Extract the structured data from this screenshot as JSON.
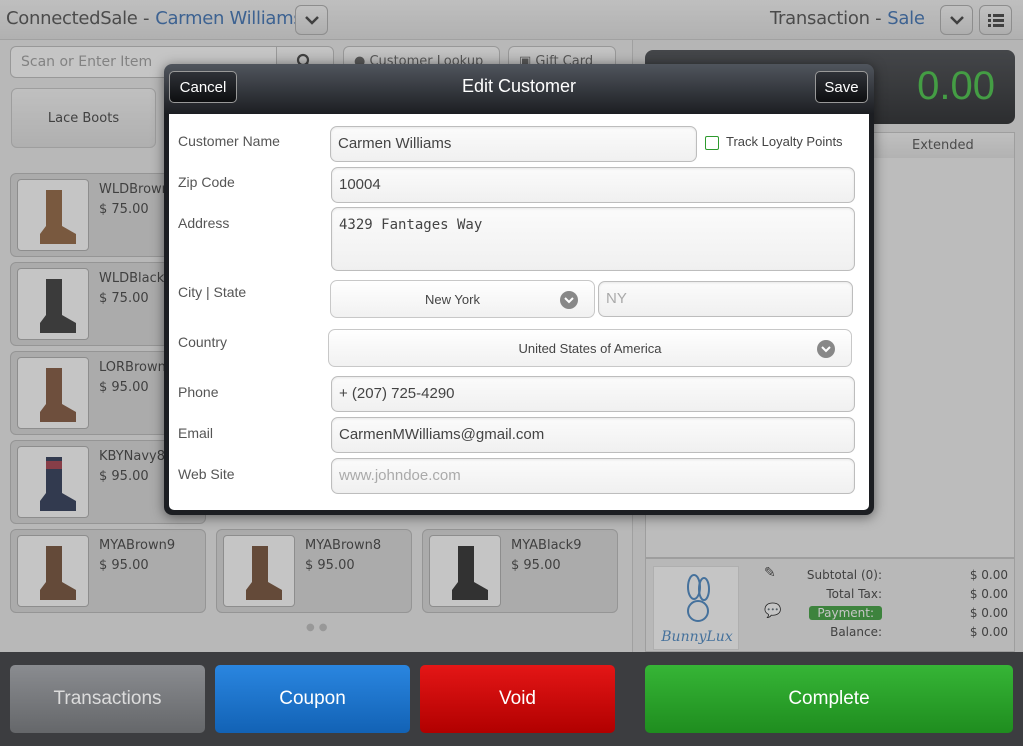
{
  "header": {
    "app_name": "ConnectedSale -",
    "customer": "Carmen Williams",
    "transaction_label": "Transaction -",
    "transaction_type": "Sale"
  },
  "toolbar": {
    "scan_placeholder": "Scan or Enter Item",
    "customer_lookup": "Customer Lookup",
    "gift_card": "Gift Card"
  },
  "categories": [
    {
      "label": "Lace Boots"
    }
  ],
  "products": [
    {
      "name": "WLDBrown",
      "price": "$ 75.00",
      "color": "#8a5a32"
    },
    {
      "name": "WLDBlack",
      "price": "$ 75.00",
      "color": "#2b2b2b"
    },
    {
      "name": "LORBrown",
      "price": "$ 95.00",
      "color": "#7a4a2e"
    },
    {
      "name": "KBYNavy8",
      "price": "$ 95.00",
      "color": "#1e2a4a"
    },
    {
      "name": "MYABrown9",
      "price": "$ 95.00",
      "color": "#6a4328"
    },
    {
      "name": "MYABrown8",
      "price": "$ 95.00",
      "color": "#6a4328"
    },
    {
      "name": "MYABlack9",
      "price": "$ 95.00",
      "color": "#1e1e1e"
    }
  ],
  "total": {
    "symbol": "$",
    "amount": "0.00"
  },
  "grid": {
    "extended_header": "Extended"
  },
  "summary": {
    "logo_text": "BunnyLux",
    "subtotal_label": "Subtotal (0):",
    "subtotal_value": "$ 0.00",
    "tax_label": "Total Tax:",
    "tax_value": "$ 0.00",
    "payment_label": "Payment:",
    "payment_value": "$ 0.00",
    "balance_label": "Balance:",
    "balance_value": "$ 0.00"
  },
  "bottom_buttons": {
    "transactions": "Transactions",
    "coupon": "Coupon",
    "void": "Void",
    "complete": "Complete"
  },
  "modal": {
    "title": "Edit Customer",
    "cancel": "Cancel",
    "save": "Save",
    "track_loyalty": "Track Loyalty Points",
    "labels": {
      "name": "Customer Name",
      "zip": "Zip Code",
      "address": "Address",
      "city_state": "City | State",
      "country": "Country",
      "phone": "Phone",
      "email": "Email",
      "website": "Web Site"
    },
    "values": {
      "name": "Carmen Williams",
      "zip": "10004",
      "address": "4329 Fantages Way",
      "city": "New York",
      "state_placeholder": "NY",
      "country": "United States of America",
      "phone": "+ (207) 725-4290",
      "email": "CarmenMWilliams@gmail.com",
      "website_placeholder": "www.johndoe.com"
    }
  },
  "colors": {
    "accent_blue": "#2e68b0",
    "total_green": "#39c23a",
    "complete": "#2a9f2a",
    "void": "#c80a0a",
    "coupon": "#1a70c8"
  }
}
